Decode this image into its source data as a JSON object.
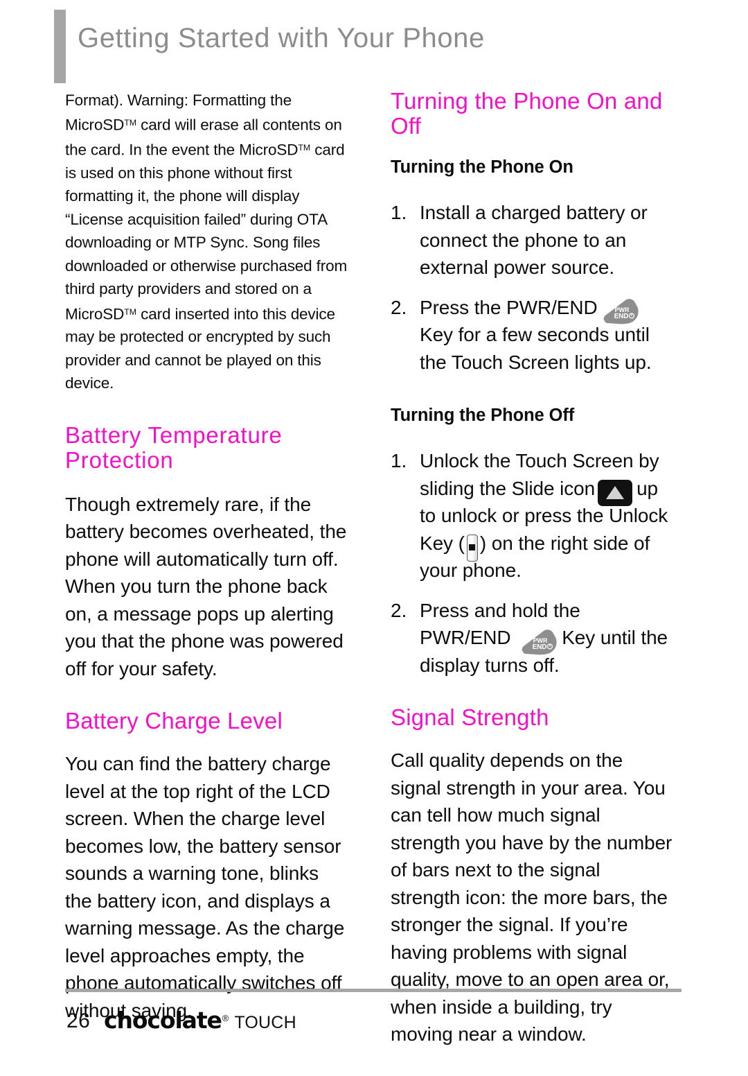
{
  "header": {
    "title": "Getting Started with Your Phone"
  },
  "colors": {
    "heading_pink": "#f50fc8",
    "header_gray": "#8c8c8c",
    "rule_gray": "#a6a6a6"
  },
  "left_column": {
    "intro_paragraph_part1": "Format). Warning: Formatting the MicroSD",
    "intro_paragraph_part2": " card will erase all contents on the card. In the event the MicroSD",
    "intro_paragraph_part3": " card is used on this phone without first formatting it, the phone will display “License acquisition failed” during OTA downloading or MTP Sync. Song files downloaded or otherwise purchased from third party providers and stored on a MicroSD",
    "intro_paragraph_part4": " card inserted into this device may be protected or encrypted by such provider and cannot be played on this device.",
    "trademark": "TM",
    "heading_battery_temperature_line1": "Battery Temperature",
    "heading_battery_temperature_line2": "Protection",
    "battery_temperature_paragraph": "Though extremely rare, if the battery becomes overheated, the phone will automatically turn off. When you turn the phone back on, a message pops up alerting you that the phone was powered off for your safety.",
    "heading_battery_charge_level": "Battery Charge Level",
    "battery_charge_level_paragraph": "You can find the battery charge level at the top right of the LCD screen. When the charge level becomes low, the battery sensor sounds a warning tone, blinks the battery icon, and displays a warning message. As the charge level approaches empty, the phone automatically switches off without saving."
  },
  "right_column": {
    "heading_turning_phone_line1": "Turning the Phone On and",
    "heading_turning_phone_line2": "Off",
    "subheading_turning_on": "Turning the Phone On",
    "on_step1_num": "1.",
    "on_step1_text": "Install a charged battery or connect the phone to an external power source.",
    "on_step2_num": "2.",
    "on_step2_text_before": "Press the PWR/END",
    "on_step2_text_after": "Key for a few seconds until the Touch Screen lights up.",
    "subheading_turning_off": "Turning the Phone Off",
    "off_step1_num": "1.",
    "off_step1_text_a": "Unlock the Touch Screen by sliding the Slide icon",
    "off_step1_text_b": "up to unlock or press the Unlock Key (",
    "off_step1_text_c": ") on the right side of your phone.",
    "off_step2_num": "2.",
    "off_step2_text_before": "Press and hold the PWR/END",
    "off_step2_text_after": "Key until the display turns off.",
    "heading_signal_strength": "Signal Strength",
    "signal_strength_paragraph": "Call quality depends on the signal strength in your area. You can tell how much signal strength you have by the number of bars next to the signal strength icon: the more bars, the stronger the signal. If you’re having problems with signal quality, move to an open area or, when inside a building, try moving near a window."
  },
  "icons": {
    "pwr_key_line1": "PWR",
    "pwr_key_line2": "END"
  },
  "footer": {
    "page_number": "26",
    "logo_word": "chocolate",
    "logo_registered": "®",
    "logo_suffix": "TOUCH"
  }
}
